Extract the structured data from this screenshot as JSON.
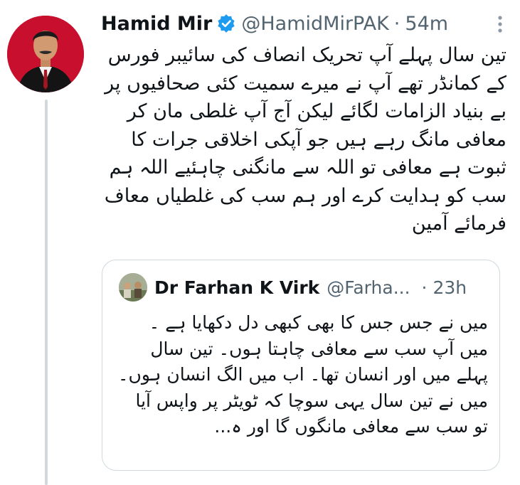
{
  "tweet": {
    "author_name": "Hamid Mir",
    "handle": "@HamidMirPAK",
    "separator": "·",
    "time": "54m",
    "text": "تین سال پہلے آپ تحریک انصاف کی سائیبر فورس کے کمانڈر تھے آپ نے میرے سمیت کئی صحافیوں پر بے بنیاد الزامات لگائے لیکن آج آپ غلطی مان کر معافی مانگ رہے ہیں جو آپکی اخلاقی جرات کا ثبوت ہے معافی تو اللہ سے مانگنی چاہئیے اللہ ہم سب کو ہدایت کرے اور ہم سب کی غلطیاں معاف فرمائے آمین",
    "icons": {
      "verified": "verified-badge-icon",
      "more": "more-options-icon"
    },
    "colors": {
      "verified": "#1d9bf0",
      "secondary_text": "#536471",
      "thread_line": "#cfd9de"
    }
  },
  "quoted_tweet": {
    "author_name": "Dr Farhan K Virk",
    "handle": "@Farha...",
    "separator": "·",
    "time": "23h",
    "text": "میں نے جس جس کا بھی کبھی دل دکھایا ہے ۔ میں آپ سب سے معافی چاہتا ہوں۔ تین سال پہلے میں اور انسان تھا۔ اب میں الگ انسان ہوں۔ میں نے تین سال یہی سوچا کہ ٹویٹر پر واپس آیا تو سب سے معافی مانگوں گا اور ہ..."
  }
}
